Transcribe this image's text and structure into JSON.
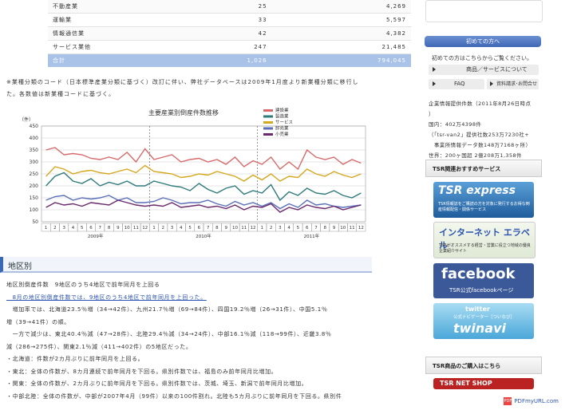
{
  "table": [
    {
      "name": "不動産業",
      "count": "25",
      "capital": "4,269"
    },
    {
      "name": "運輸業",
      "count": "33",
      "capital": "5,597"
    },
    {
      "name": "情報通信業",
      "count": "42",
      "capital": "4,382"
    },
    {
      "name": "サービス業他",
      "count": "247",
      "capital": "21,485"
    },
    {
      "name": "合計",
      "count": "1,026",
      "capital": "794,045"
    }
  ],
  "note": "※業種分類のコード（日本標準産業分類に基づく）改訂に伴い、弊社データベースは2009年1月度より新業種分類に移行した。各数値は新業種コードに基づく。",
  "chart_data": {
    "type": "line",
    "title": "主要産業別倒産件数推移",
    "ylabel": "（件）",
    "ylim": [
      50,
      450
    ],
    "yticks": [
      450,
      400,
      350,
      300,
      250,
      200,
      150,
      100,
      50
    ],
    "categories": [
      "1",
      "2",
      "3",
      "4",
      "5",
      "6",
      "7",
      "8",
      "9",
      "10",
      "11",
      "12",
      "1",
      "2",
      "3",
      "4",
      "5",
      "6",
      "7",
      "8",
      "9",
      "10",
      "11",
      "12",
      "1",
      "2",
      "3",
      "4",
      "5",
      "6",
      "7",
      "8",
      "9",
      "10",
      "11",
      "12"
    ],
    "year_labels": [
      "2009年",
      "2010年",
      "2011年"
    ],
    "series": [
      {
        "name": "建設業",
        "color": "#d66a6a",
        "values": [
          350,
          360,
          330,
          335,
          330,
          315,
          310,
          320,
          310,
          340,
          300,
          355,
          310,
          320,
          330,
          300,
          310,
          315,
          300,
          310,
          290,
          320,
          280,
          305,
          290,
          320,
          270,
          300,
          270,
          350,
          320,
          310,
          320,
          290,
          310,
          295
        ]
      },
      {
        "name": "製造業",
        "color": "#2f7a7a",
        "values": [
          200,
          240,
          255,
          220,
          210,
          230,
          200,
          215,
          205,
          220,
          200,
          200,
          220,
          210,
          200,
          195,
          180,
          210,
          185,
          170,
          190,
          200,
          165,
          180,
          170,
          205,
          140,
          175,
          160,
          190,
          170,
          165,
          180,
          160,
          150,
          170
        ]
      },
      {
        "name": "サービス",
        "color": "#d4a820",
        "values": [
          240,
          280,
          270,
          250,
          260,
          265,
          255,
          250,
          260,
          270,
          255,
          285,
          260,
          255,
          250,
          235,
          240,
          250,
          245,
          260,
          250,
          240,
          220,
          245,
          225,
          250,
          220,
          240,
          235,
          270,
          250,
          240,
          260,
          245,
          235,
          250
        ]
      },
      {
        "name": "卸売業",
        "color": "#5a6fb8",
        "values": [
          140,
          155,
          160,
          140,
          150,
          145,
          150,
          160,
          140,
          150,
          130,
          130,
          135,
          150,
          140,
          125,
          130,
          130,
          140,
          125,
          115,
          135,
          120,
          130,
          115,
          130,
          105,
          125,
          110,
          140,
          120,
          125,
          115,
          110,
          115,
          120
        ]
      },
      {
        "name": "小売業",
        "color": "#6b2a6b",
        "values": [
          110,
          130,
          120,
          125,
          115,
          130,
          125,
          120,
          140,
          130,
          120,
          115,
          120,
          115,
          130,
          110,
          115,
          120,
          110,
          115,
          105,
          120,
          100,
          115,
          110,
          125,
          90,
          110,
          100,
          120,
          110,
          105,
          115,
          100,
          110,
          120
        ]
      }
    ]
  },
  "section_title": "地区別",
  "body": [
    {
      "text": "地区別倒産件数　9地区のうち4地区で前年同月を上回る",
      "cls": ""
    },
    {
      "text": "　8月の地区別倒産件数では、9地区のうち4地区で前年同月を上回った。",
      "cls": "blue"
    },
    {
      "text": "　増加率では、北海道23.5％増（34→42件）、九州21.7％増（69→84件）、四国19.2％増（26→31件）、中国5.1％",
      "cls": ""
    },
    {
      "text": "増（39→41件）の順。",
      "cls": ""
    },
    {
      "text": "　一方で減少は、東北40.4％減（47→28件）、北陸29.4％減（34→24件）、中部16.1％減（118→99件）、近畿3.8％",
      "cls": ""
    },
    {
      "text": "減（286→275件）、関東2.1％減（411→402件）の5地区だった。",
      "cls": ""
    },
    {
      "text": " ",
      "cls": ""
    },
    {
      "text": "・北海道：件数が2カ月ぶりに前年同月を上回る。",
      "cls": ""
    },
    {
      "text": "・東北：全体の件数が、8カ月連続で前年同月を下回る。県別件数では、福島のみ前年同月比増加。",
      "cls": ""
    },
    {
      "text": "・関東：全体の件数が、2カ月ぶりに前年同月を下回る。県別件数では、茨城、埼玉、新潟で前年同月比増加。",
      "cls": ""
    },
    {
      "text": "・中部北陸：全体の件数が、中部が2007年4月（99件）以来の100件割れ。北陸も5カ月ぶりに前年同月を下回る。県別件",
      "cls": ""
    }
  ],
  "sidebar": {
    "first_time_button": "初めての方へ",
    "lead": "初めての方はこちらからご覧ください。",
    "nav1": "商品／サービスについて",
    "nav2": "FAQ",
    "nav3": "資料請求･お問合せ",
    "stats": [
      "企業情報提供件数（2011年8月26日時点",
      "）",
      "国内：402万4398件",
      "（「tsr-van2」提供社数253万7230社+",
      "　事業所情報データ数148万7168ヶ所）",
      "世界：200ヶ国超 2億208万1,358件"
    ],
    "recommend_header": "TSR関連おすすめサービス",
    "express_title": "TSR express",
    "express_sub": "TSR情報誌をご購読の方を対象に発行するお得な倒産情報配信・関係サービス",
    "erabel_title": "インターネット エラベル",
    "erabel_sub": "TSRがオススメする経営・営業に役立つ地域の優良企業紹介サイト",
    "facebook_title": "facebook",
    "facebook_sub": "TSR公式facebookページ",
    "twitter_top": "twitter",
    "twitter_mid": "公式ナビゲーター［ついなび］",
    "twitter_title": "twinavi",
    "purchase_header": "TSR商品のご購入はこちら",
    "netshop": "TSR NET SHOP"
  },
  "footer": "PDFmyURL.com"
}
